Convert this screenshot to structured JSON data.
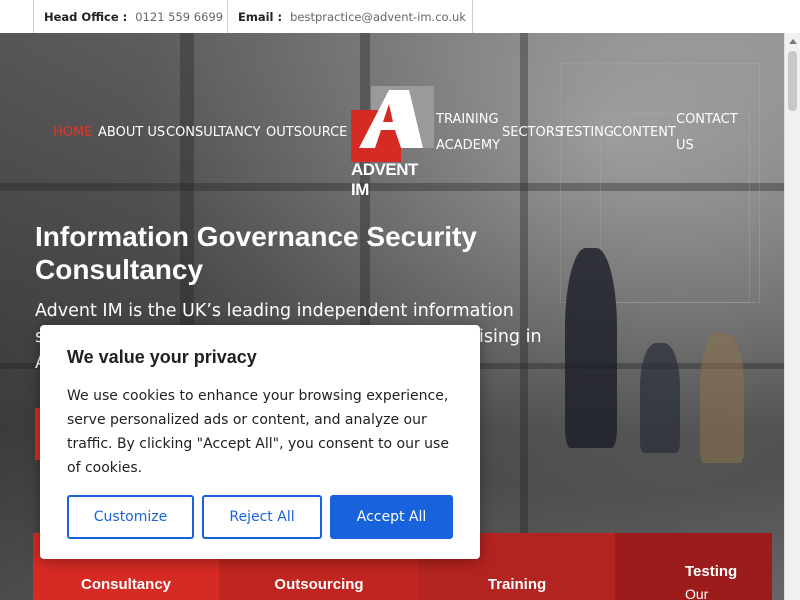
{
  "topbar": {
    "office_label": "Head Office :",
    "office_value": "0121 559 6699",
    "email_label": "Email :",
    "email_value": "bestpractice@advent-im.co.uk"
  },
  "nav": {
    "items": [
      {
        "label": "HOME",
        "active": true
      },
      {
        "label": "ABOUT US"
      },
      {
        "label": "CONSULTANCY"
      },
      {
        "label": "OUTSOURCE"
      },
      {
        "label": "TRAINING ACADEMY"
      },
      {
        "label": "SECTORS"
      },
      {
        "label": "TESTING"
      },
      {
        "label": "CONTENT"
      },
      {
        "label": "CONTACT US"
      }
    ]
  },
  "logo": {
    "text": "ADVENT IM"
  },
  "hero": {
    "title": "Information Governance Security Consultancy",
    "text": "Advent IM is the UK’s leading independent information security and physical security consultancy, specialising in Assurance, Risk and Compliance."
  },
  "tiles": [
    {
      "label": "Consultancy",
      "color": "#d62b24"
    },
    {
      "label": "Outsourcing",
      "color": "#c1251f"
    },
    {
      "label": "Training",
      "color": "#b32320"
    },
    {
      "label": "Testing",
      "sub": "Our",
      "color": "#9c1c1c"
    }
  ],
  "cookie": {
    "title": "We value your privacy",
    "body": "We use cookies to enhance your browsing experience, serve personalized ads or content, and analyze our traffic. By clicking \"Accept All\", you consent to our use of cookies.",
    "customize": "Customize",
    "reject": "Reject All",
    "accept": "Accept All"
  },
  "colors": {
    "accent": "#d62b24",
    "button_blue": "#1863dc"
  }
}
